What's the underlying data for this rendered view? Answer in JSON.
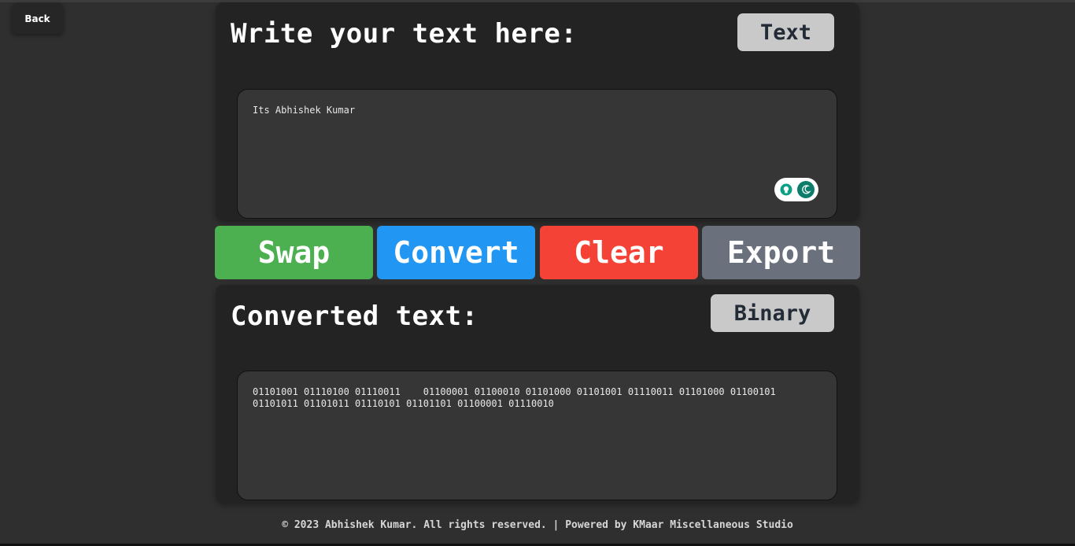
{
  "header": {
    "back_label": "Back"
  },
  "input_panel": {
    "title": "Write your text here:",
    "mode_label": "Text",
    "text_value": "Its Abhishek Kumar"
  },
  "theme_toggle": {
    "left_icon": "lightbulb-icon",
    "right_icon": "moon-icon",
    "accent_color": "#0b7d6a"
  },
  "actions": {
    "swap_label": "Swap",
    "convert_label": "Convert",
    "clear_label": "Clear",
    "export_label": "Export",
    "colors": {
      "swap": "#4caf50",
      "convert": "#2196f3",
      "clear": "#f44336",
      "export": "#6b717c"
    }
  },
  "output_panel": {
    "title": "Converted text:",
    "mode_label": "Binary",
    "text_value": "01101001 01110100 01110011    01100001 01100010 01101000 01101001 01110011 01101000 01100101 01101011 01101011 01110101 01101101 01100001 01110010"
  },
  "footer": {
    "text": "© 2023 Abhishek Kumar. All rights reserved. | Powered by KMaar Miscellaneous Studio"
  }
}
